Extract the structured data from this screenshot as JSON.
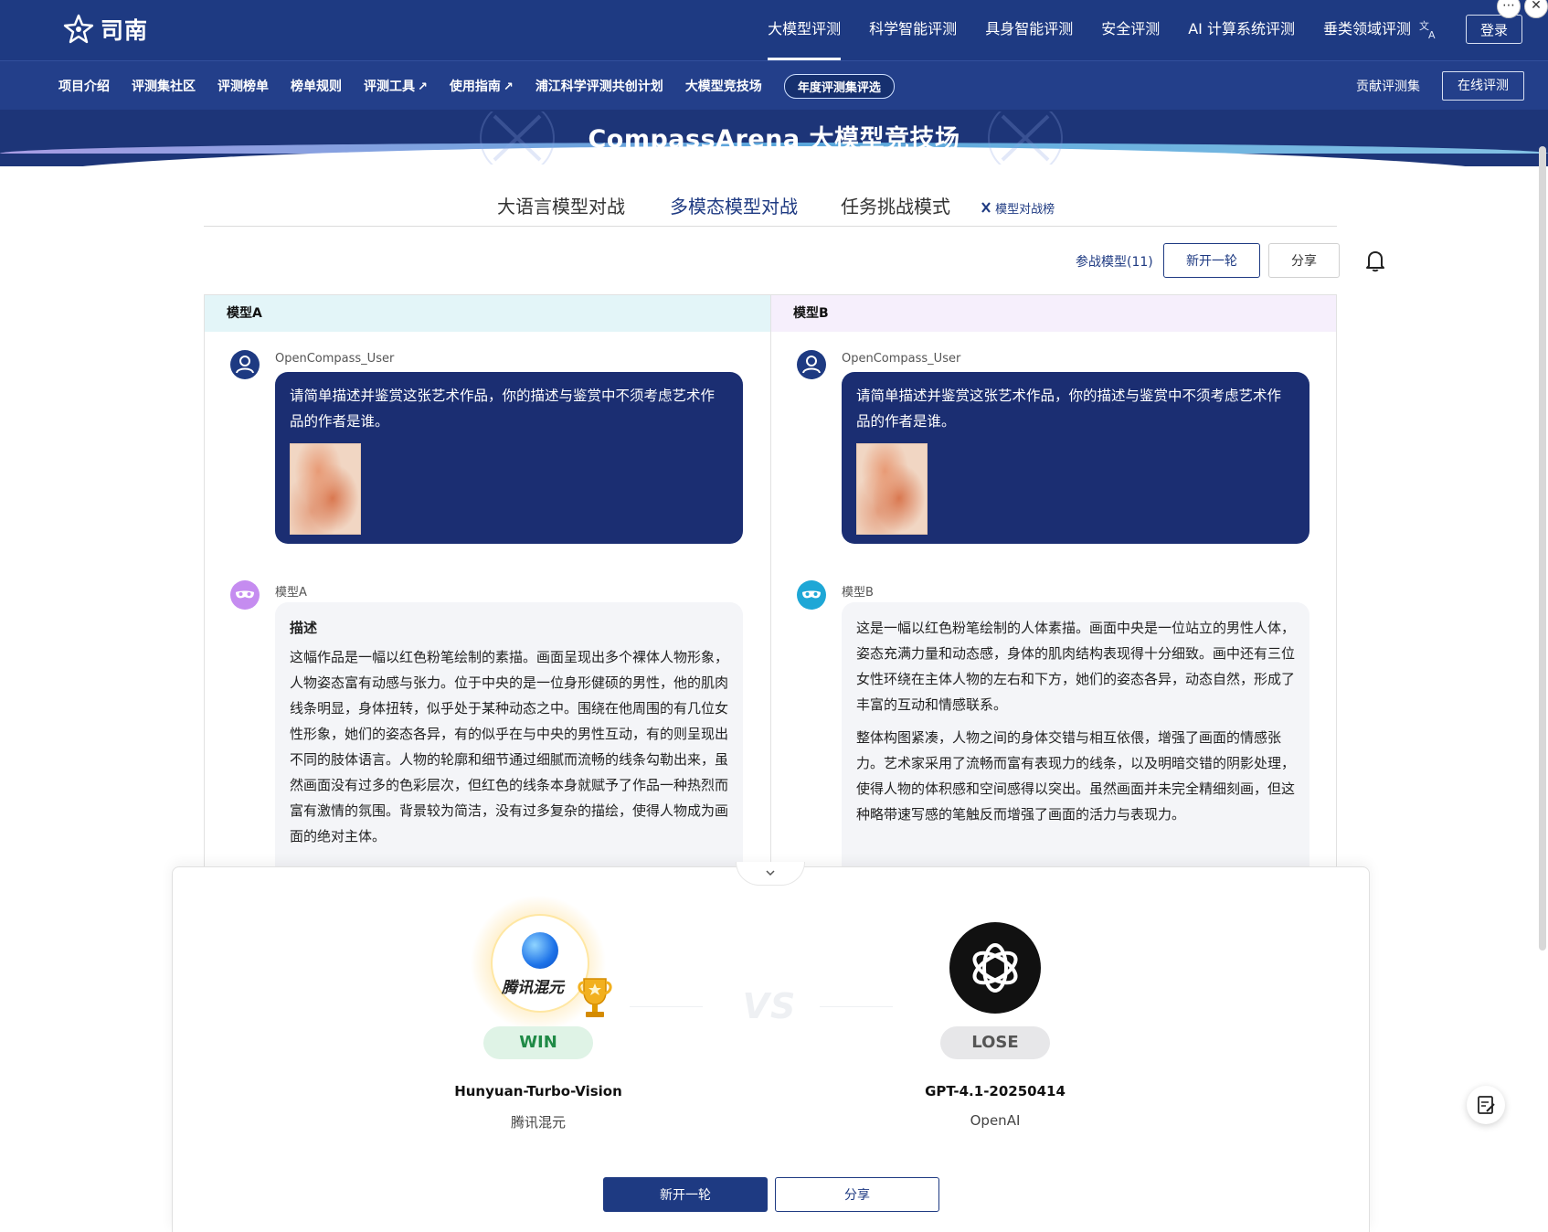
{
  "header": {
    "logo_text": "司南",
    "nav": [
      "大模型评测",
      "科学智能评测",
      "具身智能评测",
      "安全评测",
      "AI 计算系统评测",
      "垂类领域评测"
    ],
    "active_nav_index": 0,
    "login_label": "登录"
  },
  "subnav": {
    "items": [
      "项目介绍",
      "评测集社区",
      "评测榜单",
      "榜单规则",
      "评测工具",
      "使用指南",
      "浦江科学评测共创计划",
      "大模型竞技场"
    ],
    "external_arrow": "↗",
    "pill_label": "年度评测集评选",
    "contribute_label": "贡献评测集",
    "online_eval_label": "在线评测"
  },
  "banner": {
    "title": "CompassArena 大模型竞技场"
  },
  "tabs": {
    "items": [
      "大语言模型对战",
      "多模态模型对战",
      "任务挑战模式"
    ],
    "active_index": 1,
    "rank_link": "模型对战榜"
  },
  "toolbar": {
    "models_link": "参战模型(11)",
    "new_round_label": "新开一轮",
    "share_label": "分享"
  },
  "panel_a": {
    "title": "模型A",
    "user_name": "OpenCompass_User",
    "prompt": "请简单描述并鉴赏这张艺术作品，你的描述与鉴赏中不须考虑艺术作品的作者是谁。",
    "model_name": "模型A",
    "reply_heading": "描述",
    "reply_paragraphs": [
      "这幅作品是一幅以红色粉笔绘制的素描。画面呈现出多个裸体人物形象，人物姿态富有动感与张力。位于中央的是一位身形健硕的男性，他的肌肉线条明显，身体扭转，似乎处于某种动态之中。围绕在他周围的有几位女性形象，她们的姿态各异，有的似乎在与中央的男性互动，有的则呈现出不同的肢体语言。人物的轮廓和细节通过细腻而流畅的线条勾勒出来，虽然画面没有过多的色彩层次，但红色的线条本身就赋予了作品一种热烈而富有激情的氛围。背景较为简洁，没有过多复杂的描绘，使得人物成为画面的绝对主体。"
    ]
  },
  "panel_b": {
    "title": "模型B",
    "user_name": "OpenCompass_User",
    "prompt": "请简单描述并鉴赏这张艺术作品，你的描述与鉴赏中不须考虑艺术作品的作者是谁。",
    "model_name": "模型B",
    "reply_paragraphs": [
      "这是一幅以红色粉笔绘制的人体素描。画面中央是一位站立的男性人体，姿态充满力量和动态感，身体的肌肉结构表现得十分细致。画中还有三位女性环绕在主体人物的左右和下方，她们的姿态各异，动态自然，形成了丰富的互动和情感联系。",
      "整体构图紧凑，人物之间的身体交错与相互依偎，增强了画面的情感张力。艺术家采用了流畅而富有表现力的线条，以及明暗交错的阴影处理，使得人物的体积感和空间感得以突出。虽然画面并未完全精细刻画，但这种略带速写感的笔触反而增强了画面的活力与表现力。"
    ]
  },
  "result": {
    "vs_label": "VS",
    "winner": {
      "badge": "WIN",
      "name": "Hunyuan-Turbo-Vision",
      "org": "腾讯混元",
      "logo_text": "腾讯混元"
    },
    "loser": {
      "badge": "LOSE",
      "name": "GPT-4.1-20250414",
      "org": "OpenAI"
    },
    "new_round_label": "新开一轮",
    "share_label": "分享"
  },
  "colors": {
    "brand_navy": "#1e3a82",
    "win_green": "#1f8a46",
    "panel_a_head": "#e3f5f8",
    "panel_b_head": "#f6effc"
  },
  "icons": [
    "logo-mark",
    "translate-icon",
    "external-link-icon",
    "trophy-icon",
    "bell-icon",
    "user-icon",
    "mask-icon",
    "chevron-down-icon",
    "openai-icon",
    "feedback-icon"
  ]
}
